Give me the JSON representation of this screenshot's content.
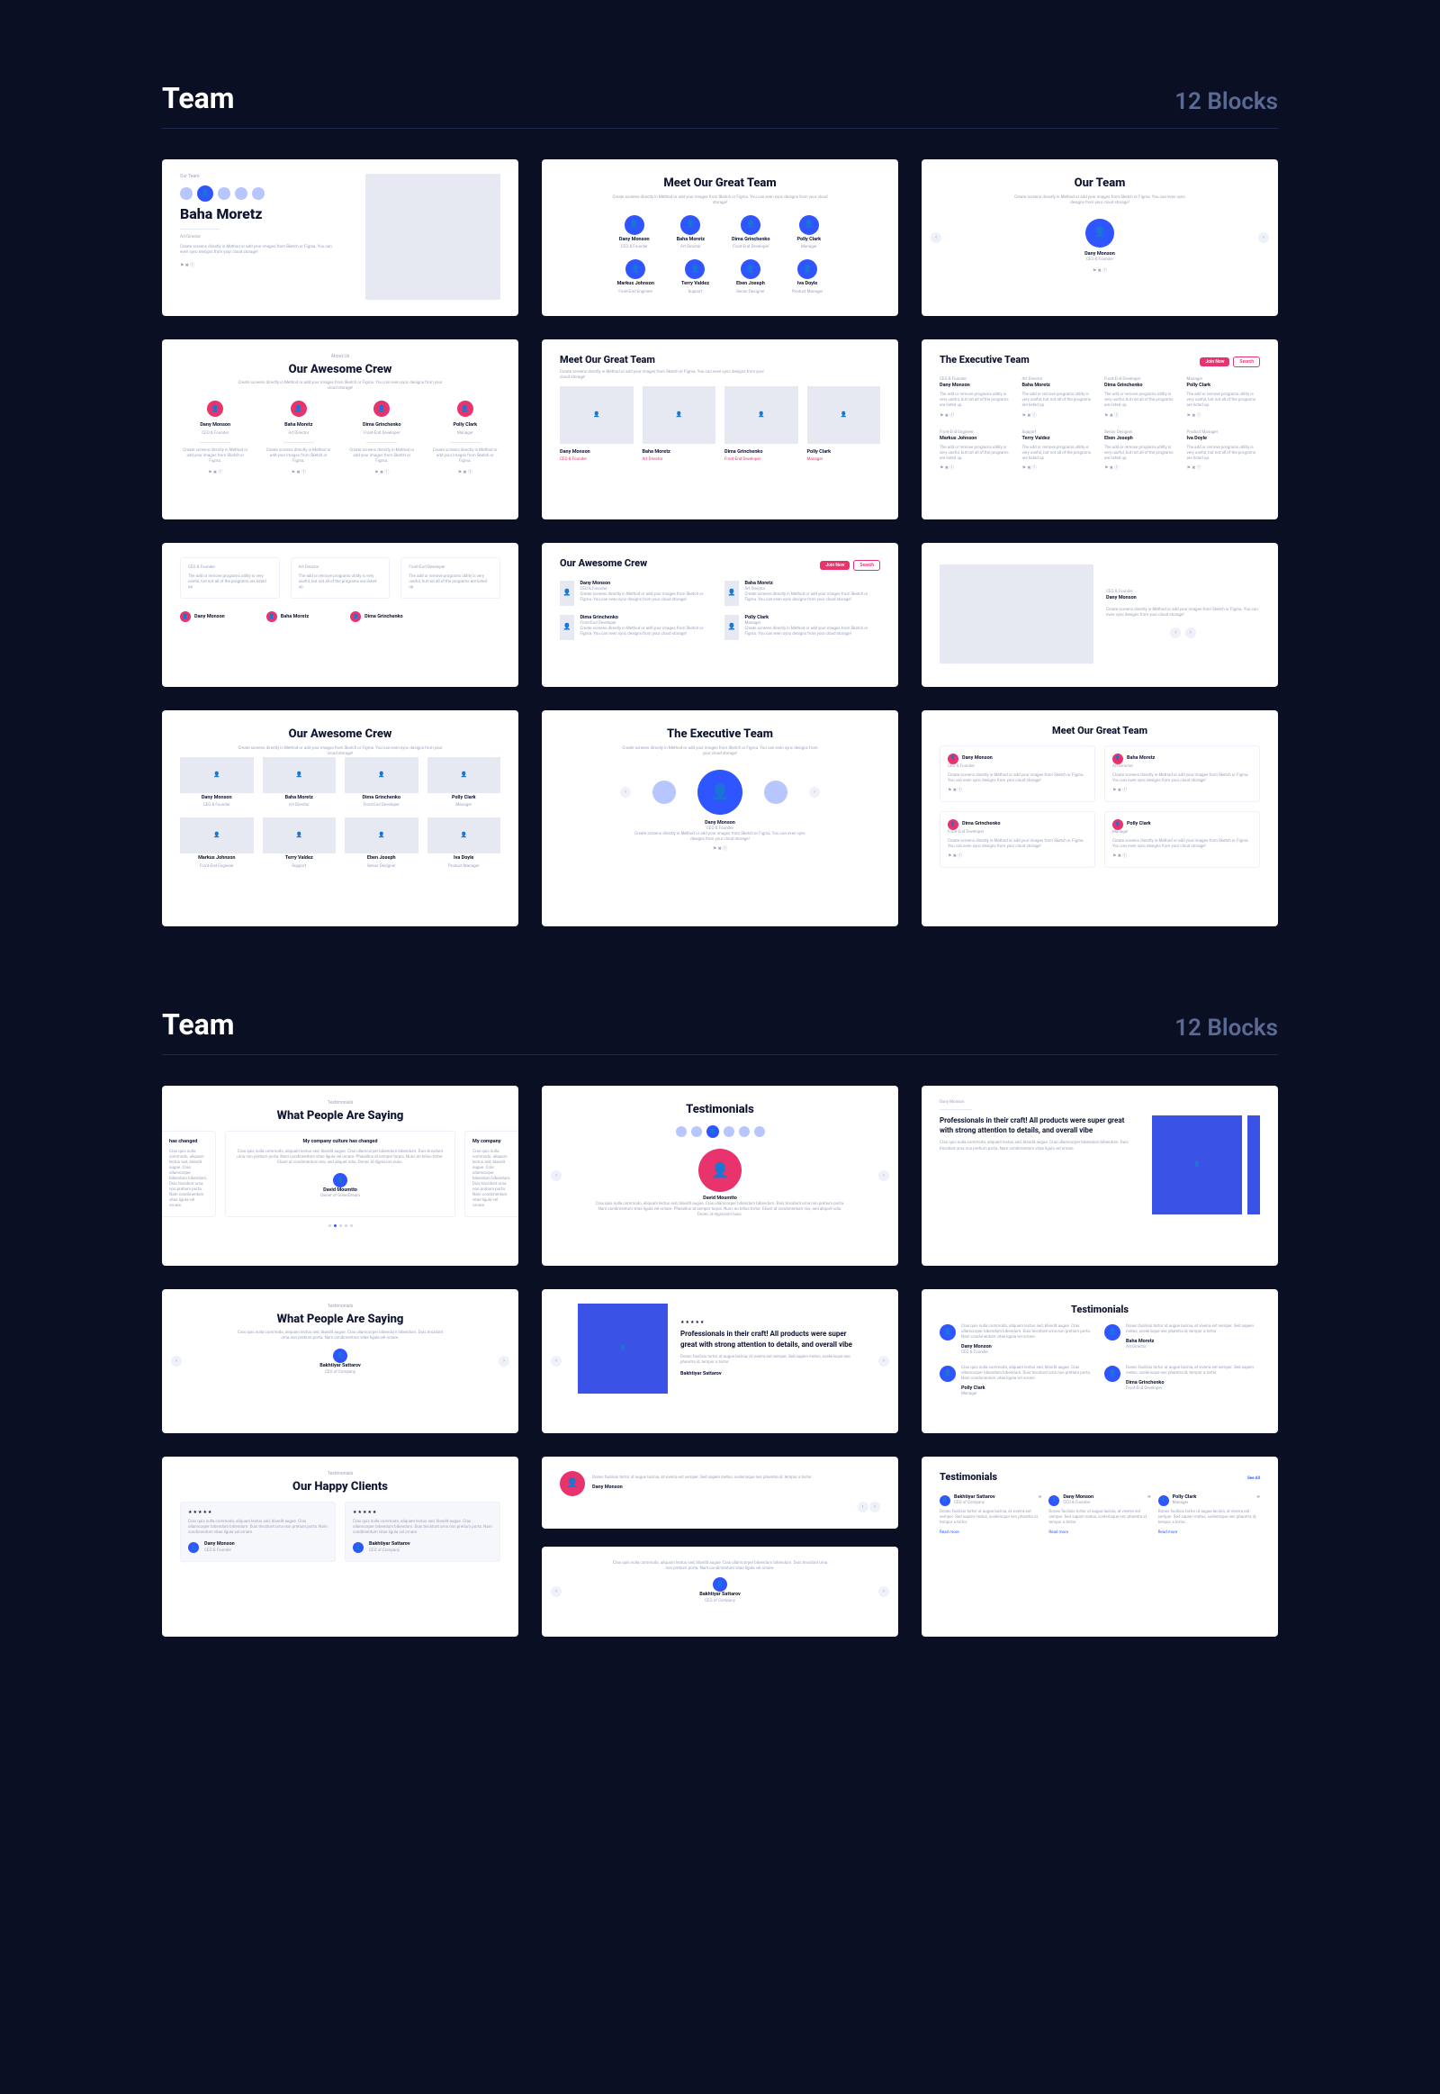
{
  "sections": [
    {
      "title": "Team",
      "count": "12 Blocks"
    },
    {
      "title": "Team",
      "count": "12 Blocks"
    }
  ],
  "common": {
    "desc_long": "Create screens directly in Method or add your images from Sketch or Figma. You can even sync designs from your cloud storage!",
    "desc_short": "Create screens directly in Method or add your images from Sketch or Figma.",
    "remove_ability": "The add or remove programs utility is very useful, but not all of the programs are listed up.",
    "lorem_long": "Cras quis nulla commodo, aliquam lectus sed, blandit augue. Cras ullamcorper bibendum bibendum. Duis tincidunt urna non pretium porta. Nam condimentum vitae ligula vel ornare. Phasellus at semper turpis. Nunc eu tellus tortor. Etiam at condimentum nisi, sed aliquet odio. Donec id dignissim nunc.",
    "lorem_med": "Cras quis nulla commodo, aliquam lectus sed, blandit augue. Cras ullamcorper bibendum bibendum. Duis tincidunt urna non pretium porta. Nam condimentum vitae ligula vel ornare.",
    "lorem_short": "Donec facilisis tortor ut augue lacinia, at viverra est semper. Sed sapien metus, scelerisque nec pharetra id, tempor a tortor.",
    "quote": "Professionals in their craft! All products were super great with strong attention to details, and overall vibe",
    "changed": "My company culture has changed",
    "changed_short": "has changed",
    "changed_tail": "My company",
    "social": "⚑  ✖  ⓕ",
    "stars5": "★★★★★",
    "see_all": "See All",
    "join_now": "Join Now",
    "search": "Search",
    "read_more": "Read more"
  },
  "people": {
    "dany": {
      "name": "Dany Monson",
      "role": "CEO & Founder"
    },
    "baha": {
      "name": "Baha Moretz",
      "role": "Art Director"
    },
    "dima": {
      "name": "Dima Grinchenko",
      "role": "Front-End Developer"
    },
    "polly": {
      "name": "Polly Clark",
      "role": "Manager"
    },
    "markus": {
      "name": "Markus Johnson",
      "role": "Front-End Engineer"
    },
    "terry": {
      "name": "Terry Valdez",
      "role": "Support"
    },
    "eben": {
      "name": "Eben Joseph",
      "role": "Senior Designer"
    },
    "iva": {
      "name": "Iva Doyle",
      "role": "Product Manager"
    },
    "david": {
      "name": "David Moumtto",
      "role": "Owner of GreenDream"
    },
    "bakh": {
      "name": "Bakhtiyar Sattarov",
      "role": "CEO of Company"
    }
  },
  "titles": {
    "our_team_k": "Our Team",
    "our_team": "Our Team",
    "meet": "Meet Our Great Team",
    "about_us": "About Us",
    "awesome": "Our Awesome Crew",
    "executive": "The Executive Team",
    "testimonials_k": "Testimonials",
    "testimonials": "Testimonials",
    "saying": "What People Are Saying",
    "happy": "Our Happy Clients"
  }
}
